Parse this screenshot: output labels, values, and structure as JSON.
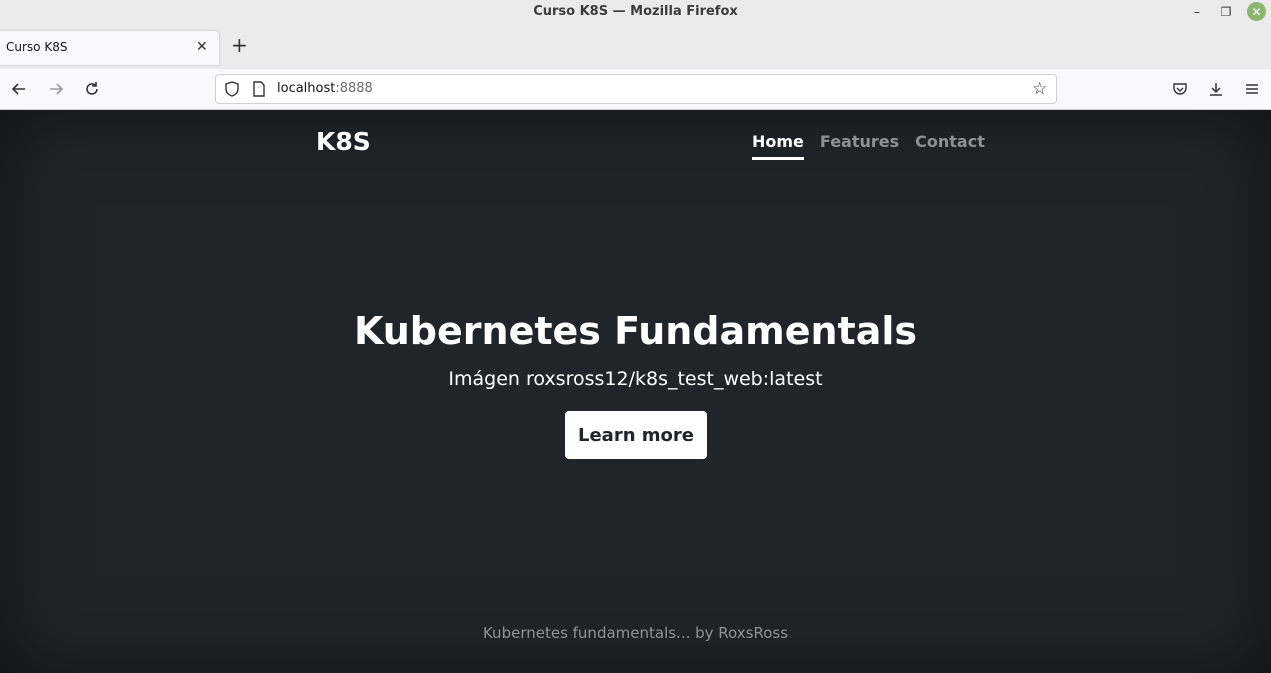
{
  "window": {
    "title": "Curso K8S — Mozilla Firefox"
  },
  "tabs": [
    {
      "title": "Curso K8S"
    }
  ],
  "urlbar": {
    "host": "localhost",
    "port": ":8888"
  },
  "page": {
    "brand": "K8S",
    "nav": [
      {
        "label": "Home",
        "active": true
      },
      {
        "label": "Features",
        "active": false
      },
      {
        "label": "Contact",
        "active": false
      }
    ],
    "hero_title": "Kubernetes Fundamentals",
    "hero_subtitle": "Imágen roxsross12/k8s_test_web:latest",
    "cta_label": "Learn more",
    "footer": "Kubernetes fundamentals... by RoxsRoss"
  },
  "colors": {
    "page_background": "#212529",
    "close_button": "#8bb86f"
  }
}
